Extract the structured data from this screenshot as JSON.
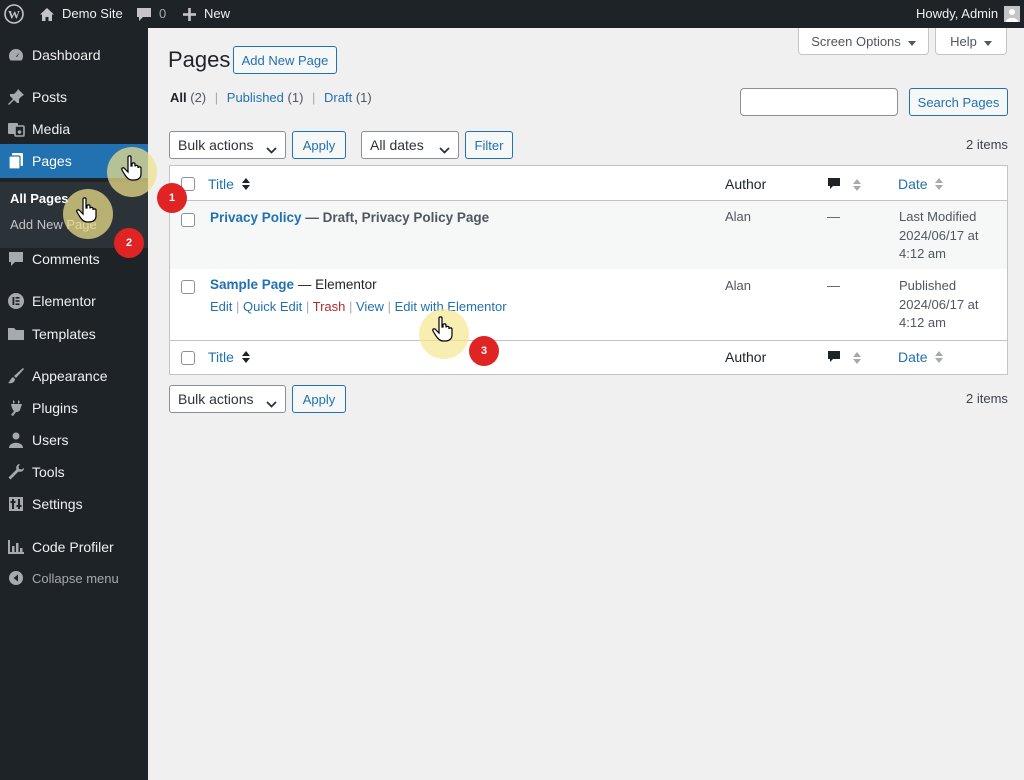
{
  "admin_bar": {
    "site_name": "Demo Site",
    "comments_count": "0",
    "new_label": "New",
    "greeting": "Howdy, Admin"
  },
  "sidebar": {
    "items": [
      {
        "label": "Dashboard",
        "icon": "dashboard-icon"
      },
      {
        "label": "Posts",
        "icon": "pin-icon"
      },
      {
        "label": "Media",
        "icon": "media-icon"
      },
      {
        "label": "Pages",
        "icon": "pages-icon",
        "current": true
      },
      {
        "label": "Comments",
        "icon": "comment-icon"
      },
      {
        "label": "Elementor",
        "icon": "elementor-icon"
      },
      {
        "label": "Templates",
        "icon": "folder-icon"
      },
      {
        "label": "Appearance",
        "icon": "brush-icon"
      },
      {
        "label": "Plugins",
        "icon": "plugin-icon"
      },
      {
        "label": "Users",
        "icon": "user-icon"
      },
      {
        "label": "Tools",
        "icon": "wrench-icon"
      },
      {
        "label": "Settings",
        "icon": "settings-icon"
      },
      {
        "label": "Code Profiler",
        "icon": "bar-chart-icon"
      }
    ],
    "submenu": [
      "All Pages",
      "Add New Page"
    ],
    "collapse_label": "Collapse menu"
  },
  "header": {
    "screen_options": "Screen Options",
    "help": "Help",
    "title": "Pages",
    "add_new": "Add New Page"
  },
  "filters": {
    "all": "All",
    "all_count": "(2)",
    "published": "Published",
    "published_count": "(1)",
    "draft": "Draft",
    "draft_count": "(1)",
    "search_placeholder": "",
    "search_button": "Search Pages"
  },
  "toolbar": {
    "bulk_actions": "Bulk actions",
    "apply": "Apply",
    "all_dates": "All dates",
    "filter": "Filter",
    "items_count": "2 items"
  },
  "table": {
    "columns": {
      "title": "Title",
      "author": "Author",
      "date": "Date"
    },
    "rows": [
      {
        "title": "Privacy Policy",
        "state": "— Draft, Privacy Policy Page",
        "author": "Alan",
        "comments": "—",
        "date_status": "Last Modified",
        "date_value": "2024/06/17 at",
        "date_time": "4:12 am"
      },
      {
        "title": "Sample Page",
        "state": "— Elementor",
        "author": "Alan",
        "comments": "—",
        "date_status": "Published",
        "date_value": "2024/06/17 at",
        "date_time": "4:12 am",
        "actions": [
          "Edit",
          "Quick Edit",
          "Trash",
          "View",
          "Edit with Elementor"
        ]
      }
    ]
  },
  "tutorial_steps": [
    "1",
    "2",
    "3"
  ],
  "colors": {
    "admin_dark": "#1d2327",
    "accent_blue": "#2271b1",
    "trash_red": "#b32d2e",
    "step_badge": "#e02424",
    "highlight": "#f5e6a0"
  }
}
